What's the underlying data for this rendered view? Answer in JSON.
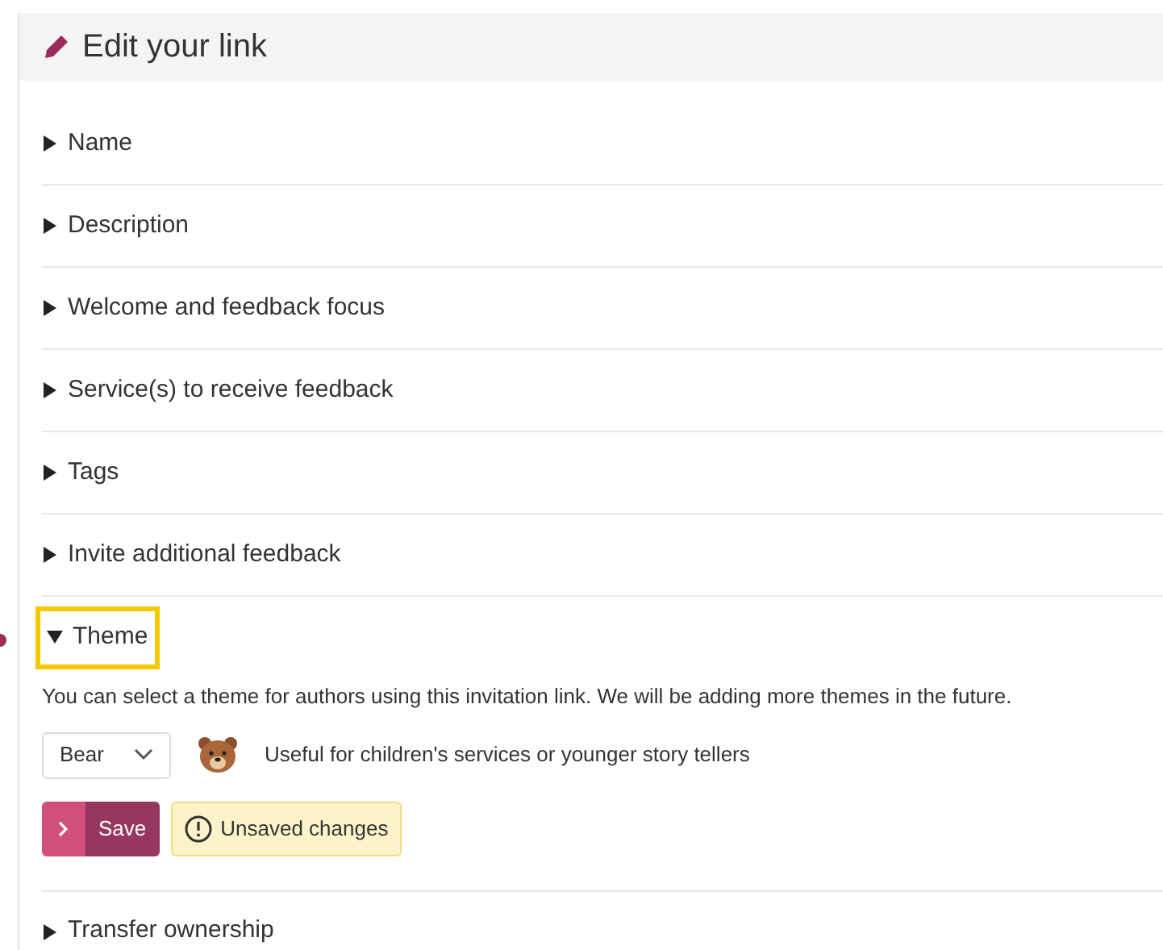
{
  "header": {
    "title": "Edit your link"
  },
  "sections": [
    {
      "label": "Name",
      "expanded": false,
      "focused": false
    },
    {
      "label": "Description",
      "expanded": false,
      "focused": false
    },
    {
      "label": "Welcome and feedback focus",
      "expanded": false,
      "focused": false
    },
    {
      "label": "Service(s) to receive feedback",
      "expanded": false,
      "focused": false
    },
    {
      "label": "Tags",
      "expanded": false,
      "focused": false
    },
    {
      "label": "Invite additional feedback",
      "expanded": false,
      "focused": false
    },
    {
      "label": "Theme",
      "expanded": true,
      "focused": true,
      "content": {
        "description": "You can select a theme for authors using this invitation link. We will be adding more themes in the future.",
        "theme_select": {
          "value": "Bear"
        },
        "theme_note": "Useful for children's services or younger story tellers",
        "save_button": "Save",
        "status_badge": "Unsaved changes"
      }
    },
    {
      "label": "Transfer ownership",
      "expanded": false,
      "focused": false
    }
  ]
}
